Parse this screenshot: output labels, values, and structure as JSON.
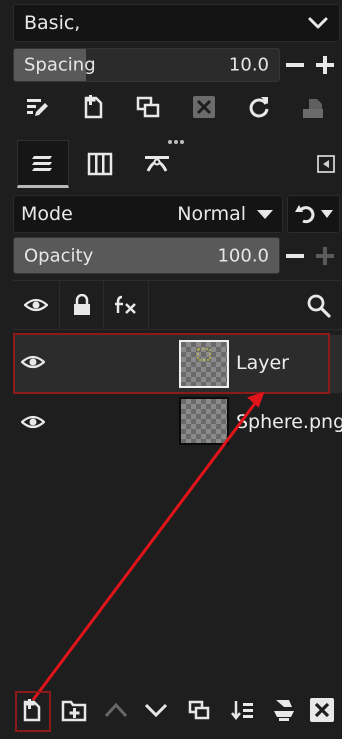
{
  "brush_preset": {
    "value": "Basic,"
  },
  "spacing": {
    "label": "Spacing",
    "value": "10.0",
    "fill_fraction": 0.27
  },
  "mode": {
    "label": "Mode",
    "value": "Normal"
  },
  "opacity": {
    "label": "Opacity",
    "value": "100.0",
    "fill_fraction": 1.0
  },
  "layers": [
    {
      "name": "Layer",
      "visible": true,
      "selected": true
    },
    {
      "name": "Sphere.png",
      "visible": true,
      "selected": false
    }
  ],
  "colors": {
    "background": "#1e1e1e",
    "highlight": "#8b1a1a",
    "arrow": "#e0141a"
  }
}
